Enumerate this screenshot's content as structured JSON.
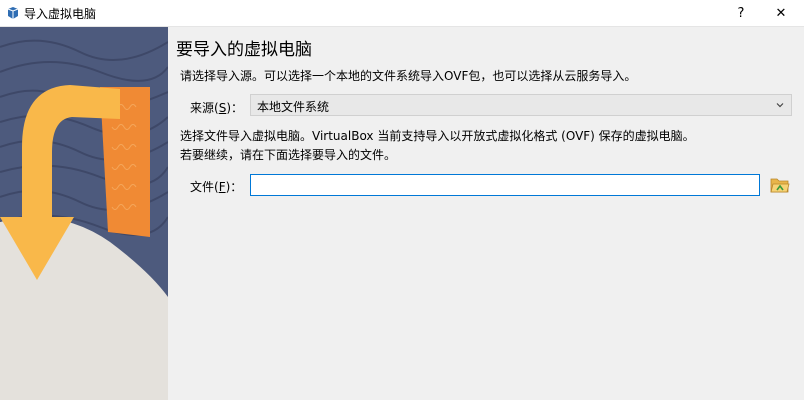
{
  "window": {
    "title": "导入虚拟电脑",
    "help_label": "?",
    "close_label": "✕"
  },
  "page": {
    "heading": "要导入的虚拟电脑",
    "intro": "请选择导入源。可以选择一个本地的文件系统导入OVF包，也可以选择从云服务导入。",
    "source_label_prefix": "来源(",
    "source_label_key": "S",
    "source_label_suffix": ")：",
    "source_value": "本地文件系统",
    "desc_line1": "选择文件导入虚拟电脑。VirtualBox 当前支持导入以开放式虚拟化格式 (OVF) 保存的虚拟电脑。",
    "desc_line2": "若要继续，请在下面选择要导入的文件。",
    "file_label_prefix": "文件(",
    "file_label_key": "F",
    "file_label_suffix": ")：",
    "file_value": ""
  },
  "icons": {
    "app": "virtualbox-icon",
    "dropdown": "chevron-down-icon",
    "folder": "folder-open-icon"
  },
  "colors": {
    "art_background": "#4d5a7d",
    "art_hill": "#e4e1dc",
    "arrow_yellow": "#f9b84a",
    "arrow_orange": "#f08a34",
    "focus_border": "#0078d7"
  }
}
